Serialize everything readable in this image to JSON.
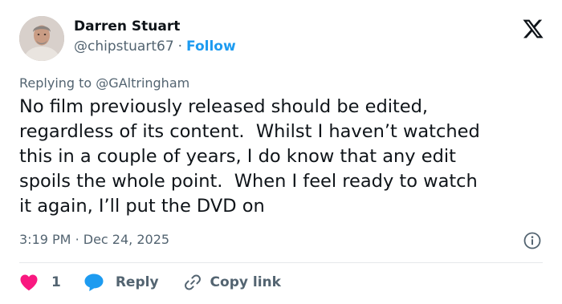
{
  "author": {
    "name": "Darren Stuart",
    "handle": "@chipstuart67",
    "separator": "·",
    "follow_label": "Follow"
  },
  "reply_context": {
    "prefix": "Replying to",
    "mention": "@GAltringham"
  },
  "tweet": {
    "lines": [
      "No film previously released should be edited,",
      "regardless of its content.  Whilst I haven’t watched",
      "this in a couple of years, I do know that any edit",
      "spoils the whole point.  When I feel ready to watch",
      "it again, I’ll put the DVD on"
    ]
  },
  "meta": {
    "time": "3:19 PM",
    "separator": "·",
    "date": "Dec 24, 2025"
  },
  "actions": {
    "like_count": "1",
    "reply_label": "Reply",
    "copy_link_label": "Copy link"
  },
  "colors": {
    "accent": "#1d9bf0",
    "like": "#f91880",
    "secondary_text": "#536471",
    "primary_text": "#0f1419",
    "divider": "#e5e8eb"
  },
  "icons": {
    "logo": "x-logo-icon",
    "info": "info-icon",
    "like": "heart-icon",
    "reply": "speech-bubble-icon",
    "copy": "link-icon"
  }
}
